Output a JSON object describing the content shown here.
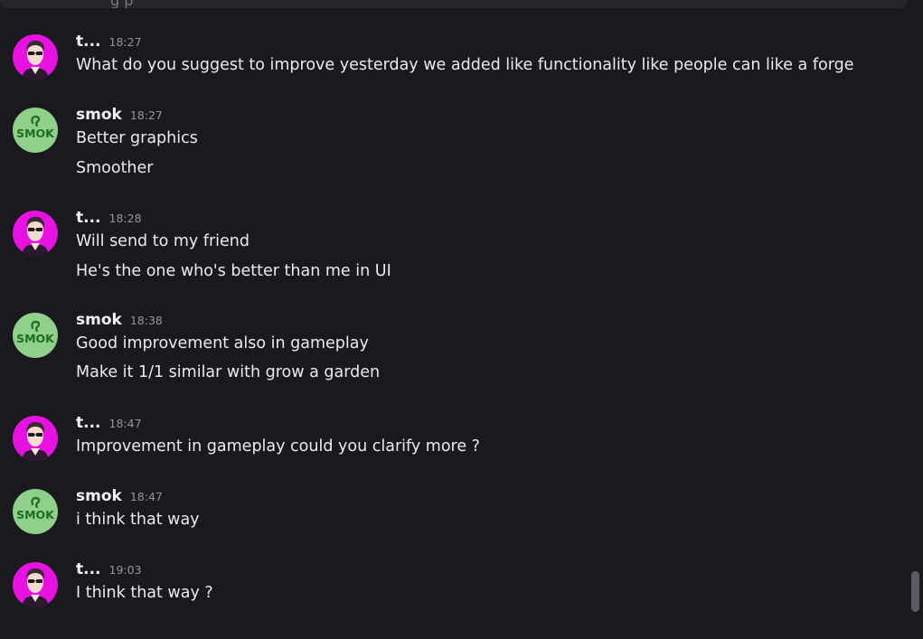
{
  "top_partial_text": "g      p",
  "smok_avatar_text": "SMOK",
  "messages": [
    {
      "author": "t...",
      "time": "18:27",
      "avatar": "person-avatar",
      "lines": [
        "What do you suggest to improve yesterday we added like functionality like people can like a forge"
      ]
    },
    {
      "author": "smok",
      "time": "18:27",
      "avatar": "smok-avatar",
      "lines": [
        "Better graphics",
        "Smoother"
      ]
    },
    {
      "author": "t...",
      "time": "18:28",
      "avatar": "person-avatar",
      "lines": [
        "Will send to my friend",
        "He's the one who's better than me in UI"
      ]
    },
    {
      "author": "smok",
      "time": "18:38",
      "avatar": "smok-avatar",
      "lines": [
        "Good improvement also in gameplay",
        "Make it 1/1 similar with grow a garden"
      ]
    },
    {
      "author": "t...",
      "time": "18:47",
      "avatar": "person-avatar",
      "lines": [
        "Improvement in gameplay could you clarify more ?"
      ]
    },
    {
      "author": "smok",
      "time": "18:47",
      "avatar": "smok-avatar",
      "lines": [
        "i think that way"
      ]
    },
    {
      "author": "t...",
      "time": "19:03",
      "avatar": "person-avatar",
      "lines": [
        "I think that way ?"
      ]
    }
  ],
  "colors": {
    "background": "#1a1a1e",
    "person_avatar_bg": "#e812e0",
    "smok_avatar_bg": "#8fd08a",
    "smok_avatar_text": "#1d6b24",
    "username": "#f2f3f5",
    "timestamp": "#94949c",
    "message_text": "#ebebef"
  }
}
